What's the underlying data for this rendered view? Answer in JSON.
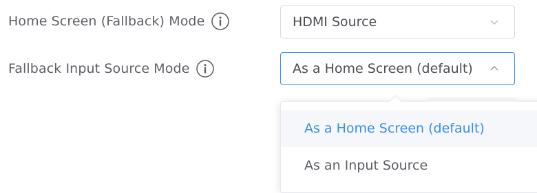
{
  "fields": [
    {
      "label": "Home Screen (Fallback) Mode",
      "value": "HDMI Source",
      "open": false,
      "info_icon": "info-circle-icon"
    },
    {
      "label": "Fallback Input Source Mode",
      "value": "As a Home Screen (default)",
      "open": true,
      "info_icon": "info-circle-icon"
    }
  ],
  "dropdown": {
    "options": [
      {
        "label": "As a Home Screen (default)",
        "selected": true
      },
      {
        "label": "As an Input Source",
        "selected": false
      }
    ]
  },
  "colors": {
    "accent": "#3a8ee6",
    "border": "#d7dbe0",
    "text": "#5d6167",
    "selected_bg": "#f5f7fa"
  }
}
